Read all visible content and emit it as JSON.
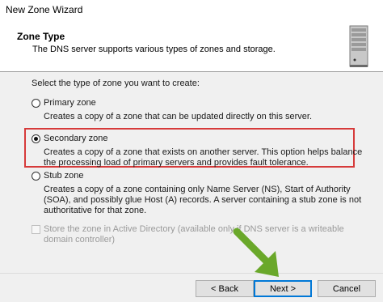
{
  "window": {
    "title": "New Zone Wizard"
  },
  "header": {
    "title": "Zone Type",
    "description": "The DNS server supports various types of zones and storage.",
    "icon": "server-icon"
  },
  "main": {
    "prompt": "Select the type of zone you want to create:",
    "options": [
      {
        "label": "Primary zone",
        "description": "Creates a copy of a zone that can be updated directly on this server.",
        "selected": false
      },
      {
        "label": "Secondary zone",
        "description": "Creates a copy of a zone that exists on another server. This option helps balance the processing load of primary servers and provides fault tolerance.",
        "selected": true
      },
      {
        "label": "Stub zone",
        "description": "Creates a copy of a zone containing only Name Server (NS), Start of Authority (SOA), and possibly glue Host (A) records. A server containing a stub zone is not authoritative for that zone.",
        "selected": false
      }
    ],
    "store_in_ad": {
      "label": "Store the zone in Active Directory (available only if DNS server is a writeable domain controller)",
      "checked": false,
      "enabled": false
    }
  },
  "buttons": {
    "back": "< Back",
    "next": "Next >",
    "cancel": "Cancel"
  },
  "colors": {
    "highlight": "#d63a3a",
    "arrow": "#6aa82a",
    "focus": "#0078d7"
  }
}
